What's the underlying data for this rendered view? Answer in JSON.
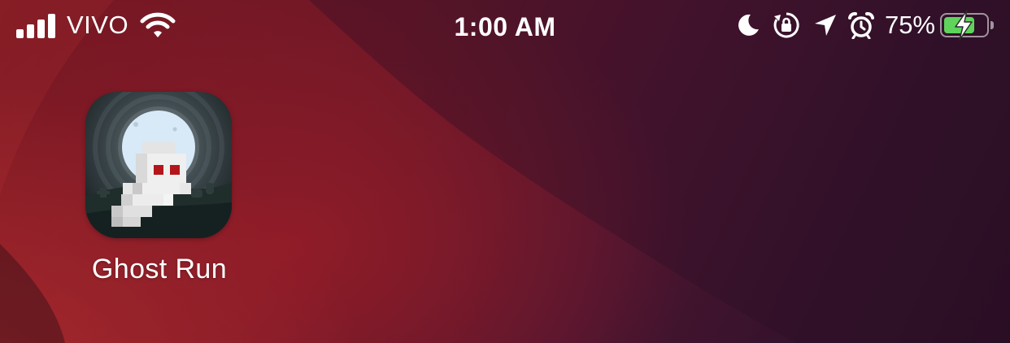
{
  "status_bar": {
    "carrier": "VIVO",
    "time": "1:00 AM",
    "battery_percent_label": "75%",
    "battery_level": 0.75,
    "icons": [
      "signal-icon",
      "wifi-icon",
      "moon-icon",
      "orientation-lock-icon",
      "location-arrow-icon",
      "alarm-icon",
      "battery-icon",
      "charging-bolt-icon"
    ]
  },
  "home": {
    "apps": [
      {
        "label": "Ghost Run",
        "icon": "ghost-run-app-icon"
      }
    ]
  },
  "colors": {
    "battery_fill": "#5fd35b",
    "wallpaper_red": "#b22c2e",
    "wallpaper_dark": "#2a0f24",
    "ghost_eye": "#b3151a"
  }
}
